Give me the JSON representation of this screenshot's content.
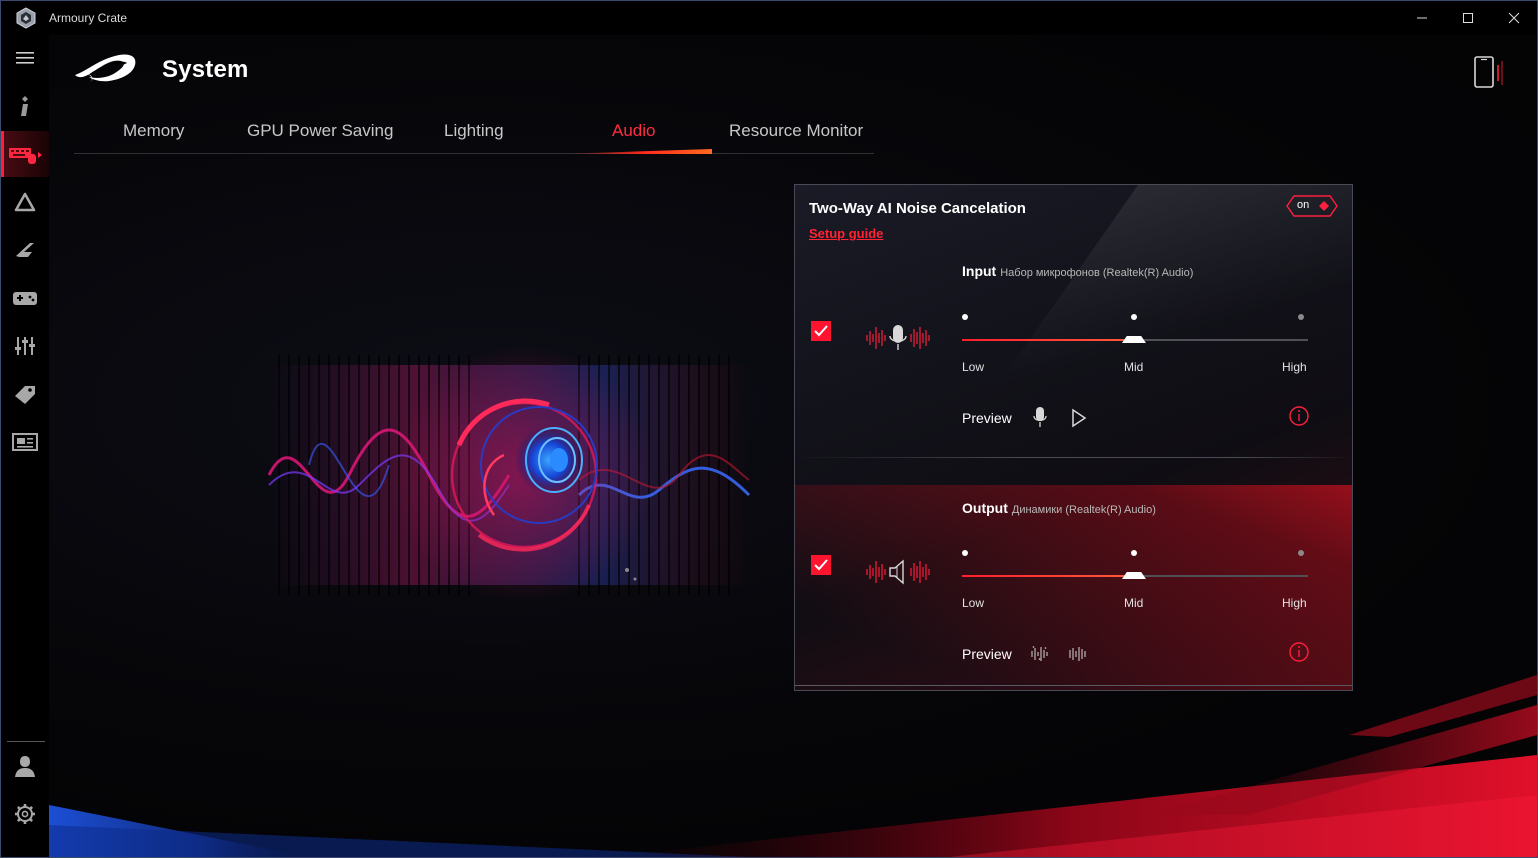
{
  "window": {
    "title": "Armoury Crate",
    "controls": [
      "minimize",
      "maximize",
      "close"
    ]
  },
  "sidebar": {
    "items": [
      {
        "name": "menu",
        "icon": "hamburger-icon"
      },
      {
        "name": "info",
        "icon": "info-icon"
      },
      {
        "name": "device",
        "icon": "keyboard-device-icon",
        "active": true
      },
      {
        "name": "aura",
        "icon": "aura-triangle-icon"
      },
      {
        "name": "armoury",
        "icon": "armoury-blade-icon"
      },
      {
        "name": "game",
        "icon": "gamepad-icon"
      },
      {
        "name": "scenario",
        "icon": "sliders-icon"
      },
      {
        "name": "deals",
        "icon": "tag-icon"
      },
      {
        "name": "news",
        "icon": "news-icon"
      }
    ],
    "bottom": [
      {
        "name": "user",
        "icon": "user-icon"
      },
      {
        "name": "settings",
        "icon": "gear-icon"
      }
    ]
  },
  "header": {
    "title": "System",
    "brand_icon": "rog-eye-logo",
    "device_icon": "phone-icon"
  },
  "tabs": [
    {
      "label": "Memory",
      "active": false
    },
    {
      "label": "GPU Power Saving",
      "active": false
    },
    {
      "label": "Lighting",
      "active": false
    },
    {
      "label": "Audio",
      "active": true
    },
    {
      "label": "Resource Monitor",
      "active": false
    }
  ],
  "panel": {
    "title": "Two-Way AI Noise Cancelation",
    "setup_link": "Setup guide",
    "toggle": "on",
    "input": {
      "label": "Input",
      "device": "Набор микрофонов (Realtek(R) Audio)",
      "checked": true,
      "icon": "microphone-wave-icon",
      "levels": [
        "Low",
        "Mid",
        "High"
      ],
      "selected_level": "Mid",
      "preview_label": "Preview",
      "preview_icons": [
        "microphone-icon",
        "play-icon"
      ]
    },
    "output": {
      "label": "Output",
      "device": "Динамики (Realtek(R) Audio)",
      "checked": true,
      "icon": "speaker-wave-icon",
      "levels": [
        "Low",
        "Mid",
        "High"
      ],
      "selected_level": "Mid",
      "preview_label": "Preview",
      "preview_icons": [
        "noisy-wave-icon",
        "clean-wave-icon"
      ]
    }
  },
  "colors": {
    "accent": "#ff1e3c",
    "background": "#050506",
    "text": "#e6e6e6",
    "blue_glow": "#1f6bff"
  }
}
